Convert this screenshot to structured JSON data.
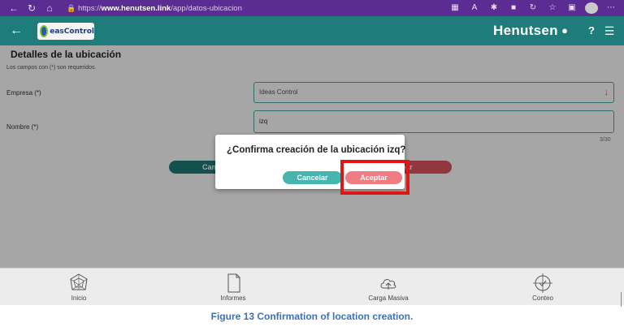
{
  "browser": {
    "url_prefix": "https://",
    "url_host": "www.henutsen.link",
    "url_path": "/app/datos-ubicacion"
  },
  "header": {
    "logo_text": "easControl",
    "brand": "Henutsen"
  },
  "page": {
    "title": "Detalles de la ubicación",
    "required_note": "Los campos con (*) son requeridos."
  },
  "form": {
    "empresa_label": "Empresa (*)",
    "empresa_value": "Ideas Control",
    "nombre_label": "Nombre (*)",
    "nombre_value": "izq",
    "counter": "3/30",
    "cancel_label": "Cancelar",
    "create_label": "Crear"
  },
  "dialog": {
    "message": "¿Confirma creación de la ubicación izq?",
    "cancel_label": "Cancelar",
    "accept_label": "Aceptar"
  },
  "bottom_nav": {
    "items": [
      {
        "label": "Inicio",
        "icon": "radar-chart-icon"
      },
      {
        "label": "Informes",
        "icon": "document-icon"
      },
      {
        "label": "Carga Masiva",
        "icon": "cloud-upload-icon"
      },
      {
        "label": "Conteo",
        "icon": "target-icon"
      }
    ]
  },
  "caption": "Figure 13 Confirmation of location creation.",
  "colors": {
    "browser_bar": "#5b2c91",
    "header": "#1e7d7a",
    "accent_teal": "#45b5b0",
    "accent_red": "#f07b82",
    "highlight": "#e01616",
    "caption": "#3f6fb5"
  }
}
